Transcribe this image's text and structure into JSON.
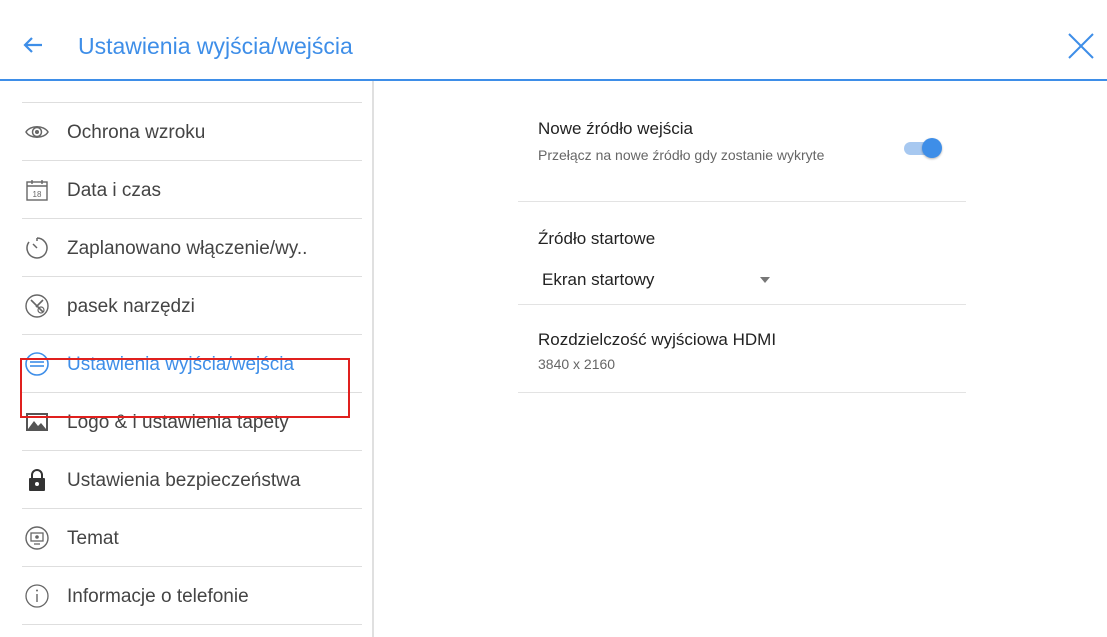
{
  "header": {
    "title": "Ustawienia wyjścia/wejścia",
    "back_icon": "arrow-left-icon",
    "close_icon": "close-icon",
    "accent_color": "#3e8ee8"
  },
  "sidebar": {
    "items": [
      {
        "label": "Ochrona wzroku",
        "icon": "eye-icon"
      },
      {
        "label": "Data i czas",
        "icon": "calendar-icon",
        "icon_text": "18"
      },
      {
        "label": "Zaplanowano włączenie/wy..",
        "icon": "timer-icon"
      },
      {
        "label": "pasek narzędzi",
        "icon": "tools-icon"
      },
      {
        "label": "Ustawienia wyjścia/wejścia",
        "icon": "input-output-icon",
        "active": true
      },
      {
        "label": "Logo & i ustawienia tapety",
        "icon": "image-icon"
      },
      {
        "label": "Ustawienia bezpieczeństwa",
        "icon": "lock-icon"
      },
      {
        "label": "Temat",
        "icon": "theme-icon"
      },
      {
        "label": "Informacje o telefonie",
        "icon": "info-icon"
      }
    ]
  },
  "settings": {
    "new_source": {
      "title": "Nowe źródło wejścia",
      "description": "Przełącz na nowe źródło gdy zostanie wykryte",
      "enabled": true
    },
    "startup_source": {
      "title": "Źródło startowe",
      "selected": "Ekran startowy"
    },
    "hdmi_resolution": {
      "title": "Rozdzielczość wyjściowa HDMI",
      "value": "3840 x 2160"
    }
  },
  "highlight_color": "#e0201e"
}
